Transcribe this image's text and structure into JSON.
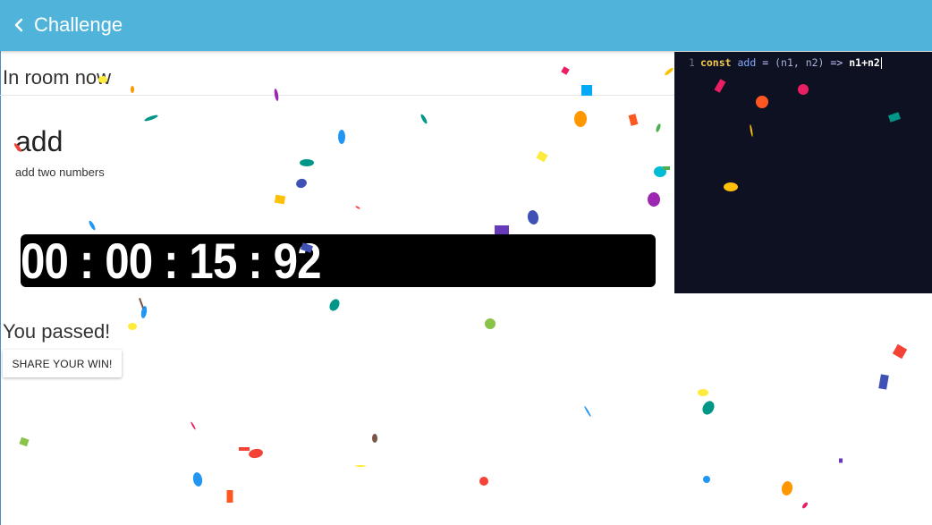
{
  "header": {
    "title": "Challenge",
    "back_icon": "chevron-left-icon",
    "color": "#50b3da"
  },
  "room": {
    "status": "In room now"
  },
  "problem": {
    "title": "add",
    "description": "add two numbers"
  },
  "timer": {
    "display": "00 : 00 : 15 : 92"
  },
  "editor": {
    "line_number": "1",
    "code": {
      "keyword": "const",
      "name": "add",
      "assign": "=",
      "params": "(n1, n2)",
      "arrow": "=>",
      "body": "n1+n2"
    },
    "background": "#0e1122"
  },
  "result": {
    "message": "You passed!",
    "share_label": "SHARE YOUR WIN!"
  },
  "confetti_colors": [
    "#e91e63",
    "#2196f3",
    "#ff9800",
    "#009688",
    "#3f51b5",
    "#ffeb3b",
    "#8bc34a",
    "#f44336",
    "#673ab7",
    "#ffc107",
    "#03a9f4",
    "#9c27b0",
    "#795548",
    "#4caf50",
    "#ff5722",
    "#00bcd4"
  ]
}
